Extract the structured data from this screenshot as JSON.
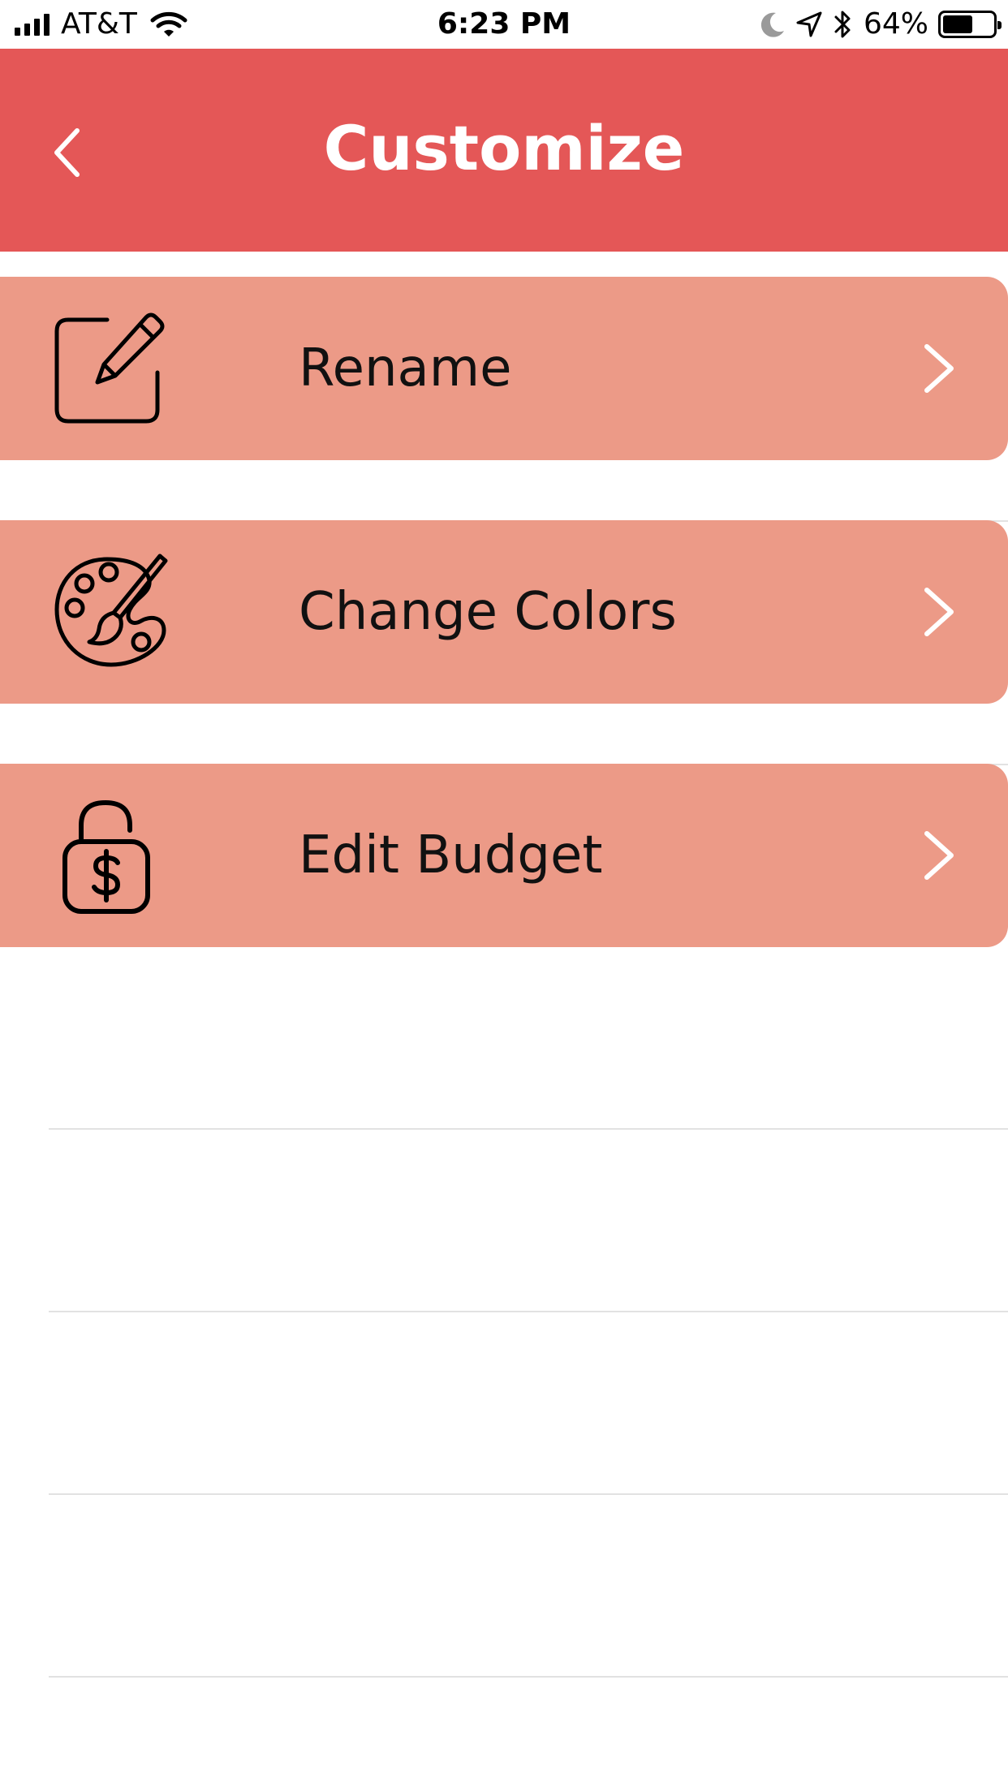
{
  "status_bar": {
    "carrier": "AT&T",
    "time": "6:23 PM",
    "battery_percent": "64%",
    "battery_level": 0.64,
    "icons": [
      "cellular-signal-icon",
      "wifi-icon",
      "moon-icon",
      "location-arrow-icon",
      "bluetooth-icon",
      "battery-icon"
    ]
  },
  "nav": {
    "title": "Customize",
    "back_icon": "chevron-left-icon"
  },
  "menu": {
    "items": [
      {
        "label": "Rename",
        "icon": "edit-pencil-icon"
      },
      {
        "label": "Change Colors",
        "icon": "palette-icon"
      },
      {
        "label": "Edit Budget",
        "icon": "unlocked-dollar-lock-icon"
      }
    ],
    "chevron_icon": "chevron-right-icon"
  },
  "colors": {
    "nav_background": "#E45757",
    "row_background": "#EC9A87",
    "text": "#111111",
    "divider": "#E2E2E2"
  }
}
